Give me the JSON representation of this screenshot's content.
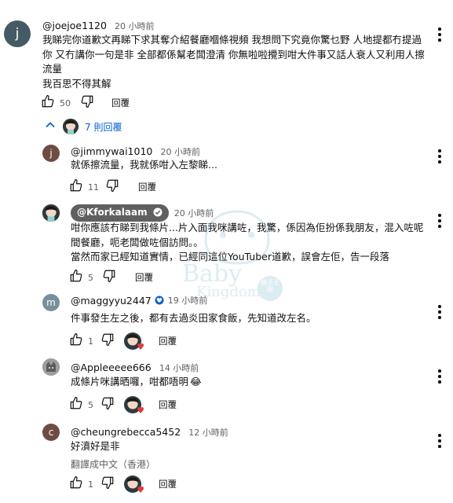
{
  "comment_top": {
    "avatar_letter": "j",
    "handle": "@joejoe1120",
    "time": "20 小時前",
    "lines": [
      "我睇完你道歉文再睇下求其奪介紹餐廳嗰條視頻 我想問下究竟你驚乜野 人地提都冇提過",
      "你 又冇講你一句是非 全部都係幫老闆澄清 你無啦啦攪到咁大件事又話人衰人又利用人擦",
      "流量",
      "我百思不得其解"
    ],
    "likes": "50",
    "reply_label": "回覆"
  },
  "replies_toggle": {
    "label": "7 則回覆"
  },
  "replies": [
    {
      "avatar_letter": "j",
      "handle": "@jimmywai1010",
      "time": "20 小時前",
      "lines": [
        "就係擦流量，我就係咁入左黎睇..."
      ],
      "likes": "11",
      "reply_label": "回覆"
    },
    {
      "handle": "@Kforkalaam",
      "time": "20 小時前",
      "lines": [
        "咁你應該冇睇到我條片...片入面我咪講咗，我驚，係因為佢扮係我朋友，混入咗呢",
        "間餐廳，呃老闆做咗個訪問。。",
        "當然而家已經知道實情，已經同這位YouTuber道歉，誤會左佢，告一段落"
      ],
      "likes": "5",
      "reply_label": "回覆"
    },
    {
      "avatar_letter": "m",
      "handle": "@maggyyu2447",
      "time": "19 小時前",
      "lines": [
        "件事發生左之後，都有去過炎田家食飯，先知道改左名。"
      ],
      "likes": "1",
      "reply_label": "回覆"
    },
    {
      "handle": "@Appleeeee666",
      "time": "14 小時前",
      "lines": [
        "成條片咪講晒囉，咁都唔明"
      ],
      "emoji": "😂",
      "likes": "5",
      "reply_label": "回覆"
    },
    {
      "avatar_letter": "c",
      "handle": "@cheungrebecca5452",
      "time": "12 小時前",
      "lines": [
        "好濆好是非"
      ],
      "translate": "翻譯成中文（香港）",
      "likes": "1",
      "reply_label": "回覆"
    }
  ],
  "watermark": {
    "line1": "Baby",
    "line2": "Kingdom",
    "badge": "親子王國"
  },
  "colors": {
    "avatar_j": "#455a64",
    "avatar_m": "#78909c",
    "avatar_c": "#6d4c41",
    "link_blue": "#065fd4",
    "heart": "#e53935"
  },
  "icons": [
    "like-icon",
    "dislike-icon",
    "kebab-menu-icon",
    "chevron-up-icon",
    "verified-icon",
    "heart-icon"
  ]
}
